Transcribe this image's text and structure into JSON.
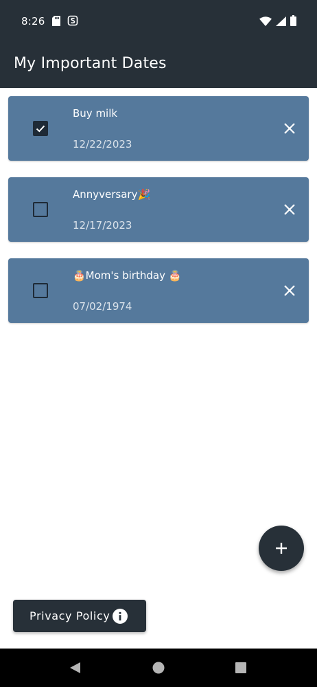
{
  "status_bar": {
    "time": "8:26",
    "left_icons": [
      "sd-card-icon",
      "app-notification-icon"
    ],
    "right_icons": [
      "wifi-icon",
      "cell-signal-icon",
      "battery-icon"
    ]
  },
  "app_bar": {
    "title": "My Important Dates"
  },
  "items": [
    {
      "title": "Buy milk",
      "date": "12/22/2023",
      "checked": true
    },
    {
      "title": "Annyversary🎉",
      "date": "12/17/2023",
      "checked": false
    },
    {
      "title": "🎂Mom's birthday 🎂",
      "date": "07/02/1974",
      "checked": false
    }
  ],
  "fab": {
    "icon": "plus-icon"
  },
  "privacy_button": {
    "label": "Privacy Policy",
    "icon": "info-icon"
  },
  "nav_bar": {
    "buttons": [
      "back-icon",
      "home-icon",
      "recents-icon"
    ]
  },
  "colors": {
    "app_bar": "#273038",
    "card": "#55799c",
    "text_white": "#ffffff",
    "date_text": "#dbe3eb",
    "checkbox": "#1e2a36",
    "nav_bar": "#000000"
  }
}
